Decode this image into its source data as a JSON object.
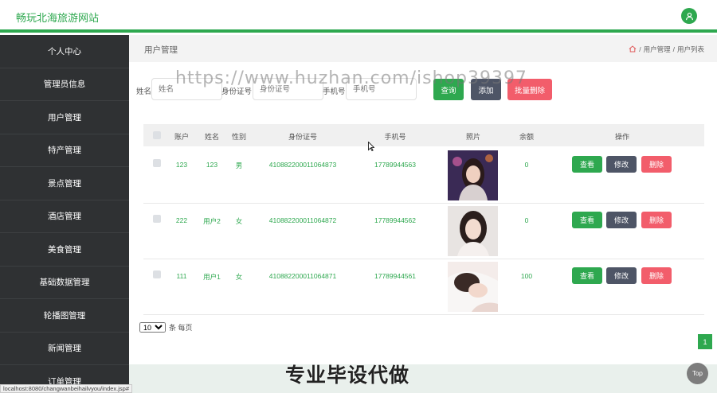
{
  "header": {
    "site_title": "畅玩北海旅游网站"
  },
  "sidebar": {
    "items": [
      {
        "label": "个人中心"
      },
      {
        "label": "管理员信息"
      },
      {
        "label": "用户管理"
      },
      {
        "label": "特产管理"
      },
      {
        "label": "景点管理"
      },
      {
        "label": "酒店管理"
      },
      {
        "label": "美食管理"
      },
      {
        "label": "基础数据管理"
      },
      {
        "label": "轮播图管理"
      },
      {
        "label": "新闻管理"
      },
      {
        "label": "订单管理"
      }
    ]
  },
  "page": {
    "title": "用户管理",
    "breadcrumb": [
      "用户管理",
      "用户列表"
    ],
    "breadcrumb_sep": "/"
  },
  "search": {
    "name_label": "姓名",
    "name_placeholder": "姓名",
    "id_label": "身份证号",
    "id_placeholder": "身份证号",
    "phone_label": "手机号",
    "phone_placeholder": "手机号",
    "query_label": "查询",
    "add_label": "添加",
    "batch_delete_label": "批量删除"
  },
  "table": {
    "headers": [
      "账户",
      "姓名",
      "性别",
      "身份证号",
      "手机号",
      "照片",
      "余额",
      "操作"
    ],
    "rows": [
      {
        "account": "123",
        "name": "123",
        "gender": "男",
        "id_number": "410882200011064873",
        "phone": "17789944563",
        "balance": "0"
      },
      {
        "account": "222",
        "name": "用户2",
        "gender": "女",
        "id_number": "410882200011064872",
        "phone": "17789944562",
        "balance": "0"
      },
      {
        "account": "111",
        "name": "用户1",
        "gender": "女",
        "id_number": "410882200011064871",
        "phone": "17789944561",
        "balance": "100"
      }
    ],
    "action_view": "查看",
    "action_edit": "修改",
    "action_delete": "删除"
  },
  "pagination": {
    "page_size": "10",
    "page_size_suffix": "条 每页",
    "current_page": "1"
  },
  "overlay": {
    "watermark": "https://www.huzhan.com/ishop39397",
    "promo": "专业毕设代做",
    "top_label": "Top"
  },
  "status": {
    "url": "localhost:8080/changwanbeihailvyou/index.jsp#"
  },
  "colors": {
    "accent": "#2ea84f",
    "sidebar": "#2f3133",
    "danger": "#f25d6b",
    "secondary": "#4e5566"
  }
}
